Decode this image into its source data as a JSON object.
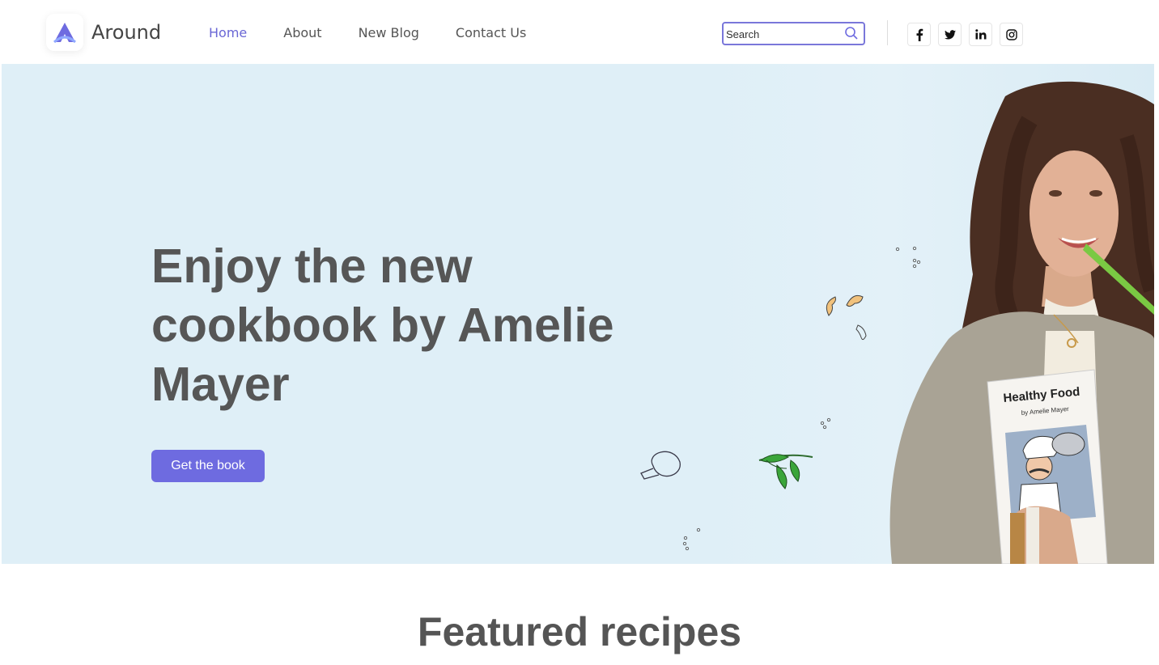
{
  "brand": {
    "name": "Around",
    "accent": "#6e6be0"
  },
  "nav": {
    "items": [
      {
        "label": "Home",
        "active": true
      },
      {
        "label": "About",
        "active": false
      },
      {
        "label": "New Blog",
        "active": false
      },
      {
        "label": "Contact Us",
        "active": false
      }
    ]
  },
  "search": {
    "placeholder": "Search",
    "icon": "search-icon"
  },
  "socials": [
    {
      "name": "facebook-icon",
      "glyph": "f"
    },
    {
      "name": "twitter-icon",
      "glyph": "t"
    },
    {
      "name": "linkedin-icon",
      "glyph": "in"
    },
    {
      "name": "instagram-icon",
      "glyph": "ig"
    }
  ],
  "hero": {
    "title": "Enjoy the new cookbook by Amelie Mayer",
    "cta_label": "Get the book",
    "book_title": "Healthy Food",
    "book_author": "by Amelie Mayer"
  },
  "featured": {
    "title": "Featured recipes"
  }
}
